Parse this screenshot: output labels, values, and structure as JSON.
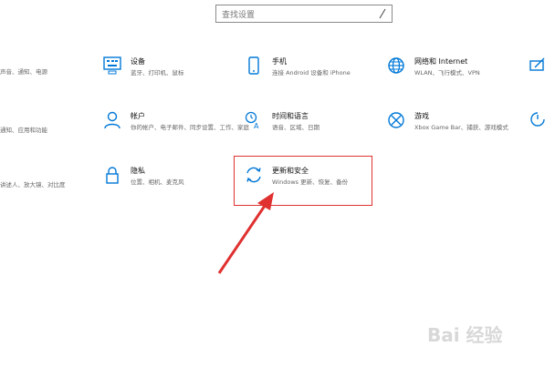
{
  "search": {
    "placeholder": "查找设置"
  },
  "tiles": [
    {
      "title": "设备",
      "desc": "蓝牙、打印机、鼠标",
      "icon": "keyboard-icon"
    },
    {
      "title": "手机",
      "desc": "连接 Android 设备和 iPhone",
      "icon": "phone-icon"
    },
    {
      "title": "网络和 Internet",
      "desc": "WLAN、飞行模式、VPN",
      "icon": "globe-icon"
    },
    {
      "title": "帐户",
      "desc": "你的帐户、电子邮件、同步设置、工作、家庭",
      "icon": "person-icon"
    },
    {
      "title": "时间和语言",
      "desc": "语音、区域、日期",
      "icon": "time-language-icon"
    },
    {
      "title": "游戏",
      "desc": "Xbox Game Bar、捕获、游戏模式",
      "icon": "xbox-icon"
    },
    {
      "title": "隐私",
      "desc": "位置、相机、麦克风",
      "icon": "lock-icon"
    },
    {
      "title": "更新和安全",
      "desc": "Windows 更新、恢复、备份",
      "icon": "refresh-icon"
    }
  ],
  "edge": {
    "row1": "声音、通知、电源",
    "row2": "通知、应用和功能",
    "row3": "讲述人、放大镜、对比度"
  },
  "watermark": "Bai 经验",
  "colors": {
    "accent": "#0078d7",
    "highlight": "#e03030"
  }
}
